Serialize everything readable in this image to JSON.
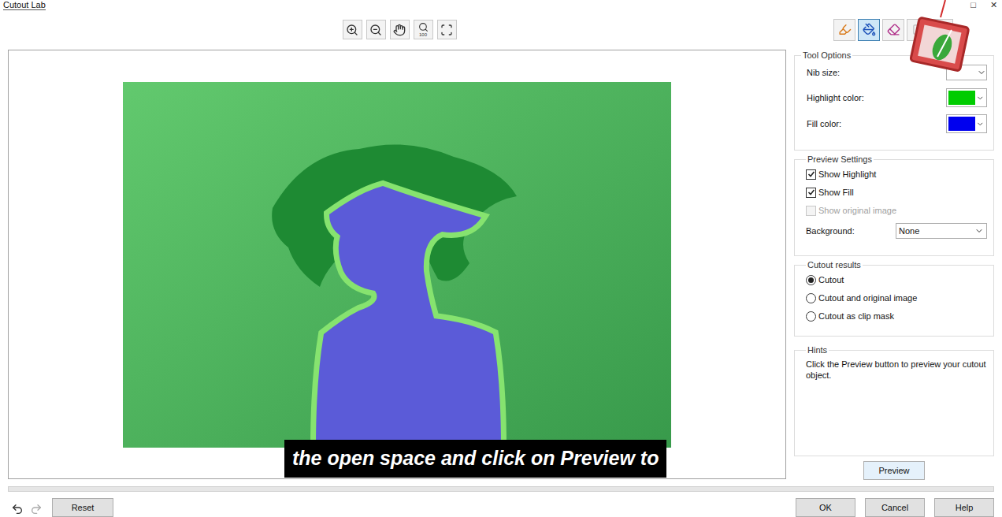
{
  "window": {
    "title": "Cutout Lab",
    "controls": [
      "□",
      "✕"
    ]
  },
  "view_tools": [
    {
      "kind": "zoomin"
    },
    {
      "kind": "zoomout"
    },
    {
      "kind": "pan"
    },
    {
      "kind": "actual",
      "label": "100"
    },
    {
      "kind": "fit"
    }
  ],
  "tools": [
    {
      "kind": "highlighter",
      "selected": false,
      "disabled": false
    },
    {
      "kind": "fill",
      "selected": true,
      "disabled": false
    },
    {
      "kind": "eraser",
      "selected": false,
      "disabled": false
    },
    {
      "kind": "extra",
      "selected": false,
      "disabled": true
    },
    {
      "kind": "extra",
      "selected": false,
      "disabled": true
    }
  ],
  "tool_options": {
    "title": "Tool Options",
    "nib_size": {
      "label": "Nib size:",
      "value": ""
    },
    "highlight_color": {
      "label": "Highlight color:",
      "color": "#00cc00"
    },
    "fill_color": {
      "label": "Fill color:",
      "color": "#0000ee"
    }
  },
  "preview_settings": {
    "title": "Preview Settings",
    "checkboxes": [
      {
        "label": "Show Highlight",
        "checked": true,
        "disabled": false
      },
      {
        "label": "Show Fill",
        "checked": true,
        "disabled": false
      },
      {
        "label": "Show original image",
        "checked": false,
        "disabled": true
      }
    ],
    "background": {
      "label": "Background:",
      "value": "None"
    }
  },
  "cutout_results": {
    "title": "Cutout results",
    "options": [
      {
        "label": "Cutout",
        "selected": true
      },
      {
        "label": "Cutout and original image",
        "selected": false
      },
      {
        "label": "Cutout as clip mask",
        "selected": false
      }
    ]
  },
  "hints": {
    "title": "Hints",
    "text": "Click the Preview button to preview your cutout object."
  },
  "preview_button": "Preview",
  "progress": {
    "level": 0
  },
  "footer": {
    "reset": "Reset",
    "buttons": [
      "OK",
      "Cancel",
      "Help"
    ]
  },
  "caption": "the open space and click on Preview to"
}
